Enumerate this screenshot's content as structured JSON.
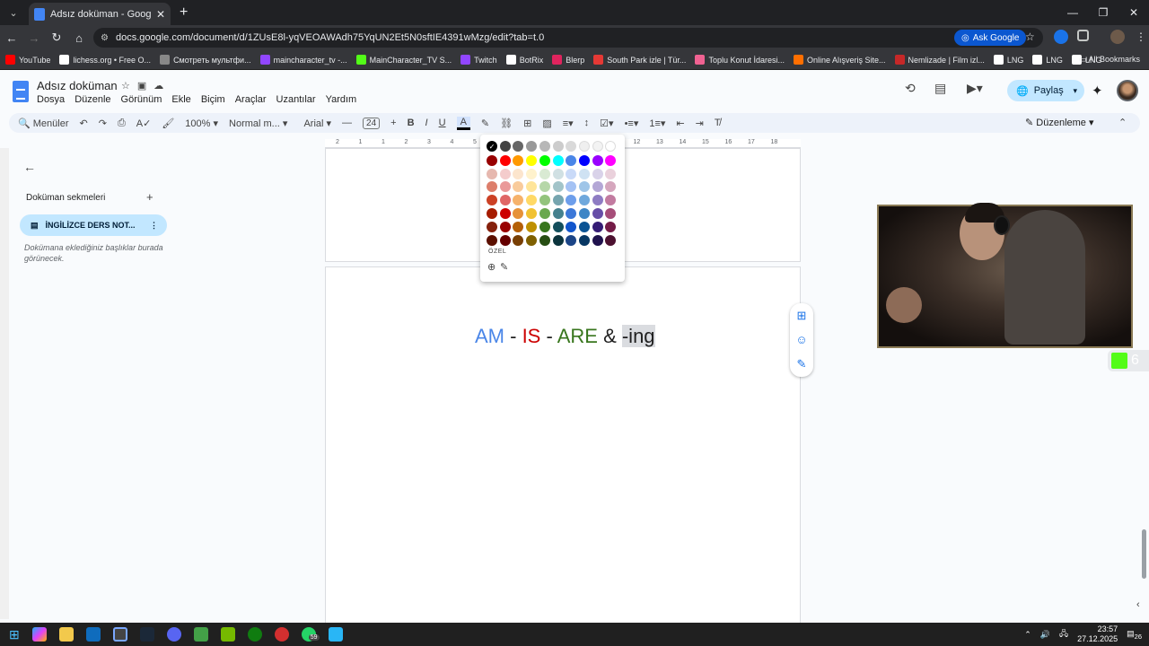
{
  "browser": {
    "tab_title": "Adsız doküman - Google Dokü",
    "url": "docs.google.com/document/d/1ZUsE8l-yqVEOAWAdh75YqUN2Et5N0sftIE4391wMzg/edit?tab=t.0",
    "ask_google": "Ask Google",
    "all_bookmarks": "All Bookmarks",
    "bookmarks": [
      {
        "label": "YouTube",
        "color": "#ff0000"
      },
      {
        "label": "lichess.org • Free O...",
        "color": "#ffffff"
      },
      {
        "label": "Смотреть мультфи...",
        "color": "#888888"
      },
      {
        "label": "maincharacter_tv -...",
        "color": "#9146ff"
      },
      {
        "label": "MainCharacter_TV S...",
        "color": "#53fc18"
      },
      {
        "label": "Twitch",
        "color": "#9146ff"
      },
      {
        "label": "BotRix",
        "color": "#ffffff"
      },
      {
        "label": "Blerp",
        "color": "#e0245e"
      },
      {
        "label": "South Park izle | Tür...",
        "color": "#e53935"
      },
      {
        "label": "Toplu Konut İdaresi...",
        "color": "#f06292"
      },
      {
        "label": "Online Alışveriş Site...",
        "color": "#ff6f00"
      },
      {
        "label": "Nemlizade | Film izl...",
        "color": "#c62828"
      },
      {
        "label": "LNG",
        "color": "#ffffff"
      },
      {
        "label": "LNG",
        "color": "#ffffff"
      },
      {
        "label": "LNG",
        "color": "#ffffff"
      }
    ]
  },
  "docs": {
    "title": "Adsız doküman",
    "menu": [
      "Dosya",
      "Düzenle",
      "Görünüm",
      "Ekle",
      "Biçim",
      "Araçlar",
      "Uzantılar",
      "Yardım"
    ],
    "share_label": "Paylaş",
    "toolbar": {
      "menus": "Menüler",
      "zoom": "100%",
      "style": "Normal m...",
      "font": "Arial",
      "font_size": "24",
      "edit_mode": "Düzenleme"
    },
    "ruler_labels": [
      "2",
      "1",
      "1",
      "2",
      "3",
      "4",
      "5",
      "6",
      "7",
      "8",
      "9",
      "10",
      "11",
      "12",
      "13",
      "14",
      "15",
      "16",
      "17",
      "18"
    ]
  },
  "sidebar": {
    "heading": "Doküman sekmeleri",
    "tab_label": "İNGİLİZCE DERS NOT...",
    "hint": "Dokümana eklediğiniz başlıklar burada görünecek."
  },
  "document": {
    "words": [
      {
        "text": "AM",
        "color": "#4a86e8"
      },
      {
        "text": " - ",
        "color": "#1f1f1f"
      },
      {
        "text": "IS",
        "color": "#cc0000"
      },
      {
        "text": " - ",
        "color": "#1f1f1f"
      },
      {
        "text": "ARE",
        "color": "#38761d"
      },
      {
        "text": " & ",
        "color": "#1f1f1f"
      }
    ],
    "selected_text": "-ing"
  },
  "palette": {
    "custom_label": "ÖZEL",
    "rows": [
      [
        "#000000",
        "#434343",
        "#666666",
        "#999999",
        "#b7b7b7",
        "#cccccc",
        "#d9d9d9",
        "#efefef",
        "#f3f3f3",
        "#ffffff"
      ],
      [
        "#980000",
        "#ff0000",
        "#ff9900",
        "#ffff00",
        "#00ff00",
        "#00ffff",
        "#4a86e8",
        "#0000ff",
        "#9900ff",
        "#ff00ff"
      ],
      [
        "#e6b8af",
        "#f4cccc",
        "#fce5cd",
        "#fff2cc",
        "#d9ead3",
        "#d0e0e3",
        "#c9daf8",
        "#cfe2f3",
        "#d9d2e9",
        "#ead1dc"
      ],
      [
        "#dd7e6b",
        "#ea9999",
        "#f9cb9c",
        "#ffe599",
        "#b6d7a8",
        "#a2c4c9",
        "#a4c2f4",
        "#9fc5e8",
        "#b4a7d6",
        "#d5a6bd"
      ],
      [
        "#cc4125",
        "#e06666",
        "#f6b26b",
        "#ffd966",
        "#93c47d",
        "#76a5af",
        "#6d9eeb",
        "#6fa8dc",
        "#8e7cc3",
        "#c27ba0"
      ],
      [
        "#a61c00",
        "#cc0000",
        "#e69138",
        "#f1c232",
        "#6aa84f",
        "#45818e",
        "#3c78d8",
        "#3d85c6",
        "#674ea7",
        "#a64d79"
      ],
      [
        "#85200c",
        "#990000",
        "#b45f06",
        "#bf9000",
        "#38761d",
        "#134f5c",
        "#1155cc",
        "#0b5394",
        "#351c75",
        "#741b47"
      ],
      [
        "#5b0f00",
        "#660000",
        "#783f04",
        "#7f6000",
        "#274e13",
        "#0c343d",
        "#1c4587",
        "#073763",
        "#20124d",
        "#4c1130"
      ]
    ]
  },
  "overlay": {
    "counter": "6"
  },
  "taskbar": {
    "time": "23:57",
    "date": "27.12.2025",
    "whatsapp_badge": "59",
    "notif": "26"
  }
}
